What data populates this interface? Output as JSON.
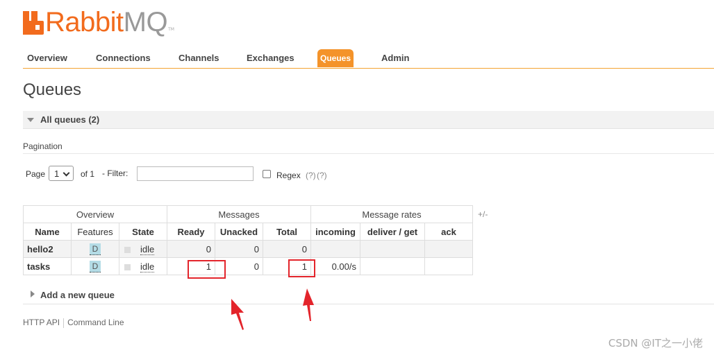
{
  "brand": {
    "name_part1": "Rabbit",
    "name_part2": "MQ",
    "tm": "TM",
    "color": "#f26b1d"
  },
  "nav": {
    "items": [
      {
        "label": "Overview"
      },
      {
        "label": "Connections"
      },
      {
        "label": "Channels"
      },
      {
        "label": "Exchanges"
      },
      {
        "label": "Queues",
        "active": true
      },
      {
        "label": "Admin"
      }
    ],
    "accent": "#f4932a"
  },
  "page_title": "Queues",
  "all_queues": {
    "label": "All queues (2)"
  },
  "pagination": {
    "section_label": "Pagination",
    "page_label": "Page",
    "page_value": "1",
    "of_label": "of 1",
    "filter_label": "- Filter:",
    "filter_value": "",
    "regex_label": "Regex",
    "help1": "(?)",
    "help2": "(?)"
  },
  "table": {
    "groups": [
      "Overview",
      "Messages",
      "Message rates"
    ],
    "columns": [
      "Name",
      "Features",
      "State",
      "Ready",
      "Unacked",
      "Total",
      "incoming",
      "deliver / get",
      "ack"
    ],
    "plus_minus": "+/-",
    "rows": [
      {
        "name": "hello2",
        "features": "D",
        "state": "idle",
        "ready": "0",
        "unacked": "0",
        "total": "0",
        "incoming": "",
        "deliver_get": "",
        "ack": ""
      },
      {
        "name": "tasks",
        "features": "D",
        "state": "idle",
        "ready": "1",
        "unacked": "0",
        "total": "1",
        "incoming": "0.00/s",
        "deliver_get": "",
        "ack": ""
      }
    ]
  },
  "add_queue": {
    "label": "Add a new queue"
  },
  "footer": {
    "links": [
      "HTTP API",
      "Command Line"
    ]
  },
  "watermark": "CSDN @IT之一小佬",
  "annotation_color": "#e3242b"
}
